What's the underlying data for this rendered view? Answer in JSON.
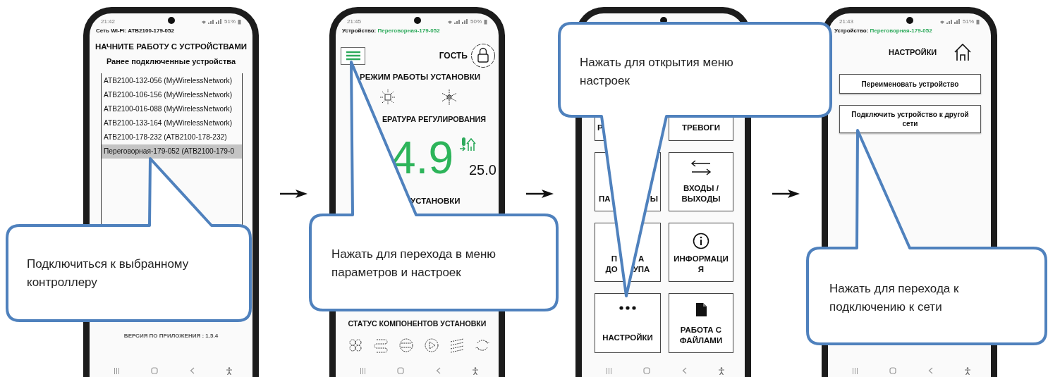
{
  "screens": [
    {
      "kind": "device_list",
      "status_bar": {
        "time": "21:42",
        "battery": "51%"
      },
      "wifi_label": "Сеть Wi-Fi: ATB2100-179-052",
      "title": "НАЧНИТЕ РАБОТУ С УСТРОЙСТВАМИ",
      "subtitle": "Ранее подключенные устройства",
      "devices": [
        {
          "label": "ATB2100-132-056 (MyWirelessNetwork)",
          "selected": false
        },
        {
          "label": "ATB2100-106-156 (MyWirelessNetwork)",
          "selected": false
        },
        {
          "label": "ATB2100-016-088 (MyWirelessNetwork)",
          "selected": false
        },
        {
          "label": "ATB2100-133-164 (MyWirelessNetwork)",
          "selected": false
        },
        {
          "label": "ATB2100-178-232 (ATB2100-178-232)",
          "selected": false
        },
        {
          "label": "Переговорная-179-052 (ATB2100-179-0",
          "selected": true
        }
      ],
      "version": "ВЕРСИЯ ПО ПРИЛОЖЕНИЯ : 1.5.4"
    },
    {
      "kind": "dashboard",
      "status_bar": {
        "time": "21:45",
        "battery": "50%"
      },
      "device_label": "Устройство:",
      "device_name": "Переговорная-179-052",
      "user": "ГОСТЬ",
      "mode_title": "РЕЖИМ РАБОТЫ УСТАНОВКИ",
      "temp_title": "ЕРАТУРА РЕГУЛИРОВАНИЯ",
      "temperature": "4.9",
      "setpoint": "25.0",
      "section_title": "УСТАНОВКИ",
      "status_title": "СТАТУС КОМПОНЕНТОВ УСТАНОВКИ"
    },
    {
      "kind": "menu",
      "tiles": [
        {
          "lines": [
            [
              "Р"
            ]
          ]
        },
        {
          "lines": [
            [
              "ТРЕВОГИ"
            ]
          ]
        },
        {
          "lines": [
            [
              "ПА",
              "Ы"
            ]
          ]
        },
        {
          "lines": [
            [
              "ВХОДЫ /"
            ],
            [
              "ВЫХОДЫ"
            ]
          ]
        },
        {
          "lines": [
            [
              "П",
              "А"
            ],
            [
              "ДО",
              "УПА"
            ]
          ]
        },
        {
          "lines": [
            [
              "ИНФОРМАЦИ"
            ],
            [
              "Я"
            ]
          ]
        },
        {
          "lines": [
            [
              "НАСТРОЙКИ"
            ]
          ]
        },
        {
          "lines": [
            [
              "РАБОТА С"
            ],
            [
              "ФАЙЛАМИ"
            ]
          ]
        }
      ]
    },
    {
      "kind": "settings",
      "status_bar": {
        "time": "21:43",
        "battery": "51%"
      },
      "device_label": "Устройство:",
      "device_name": "Переговорная-179-052",
      "title": "НАСТРОЙКИ",
      "buttons": [
        "Переименовать устройство",
        "Подключить устройство к другой сети"
      ]
    }
  ],
  "callouts": [
    {
      "text": "Подключиться к выбранному контроллеру"
    },
    {
      "text": "Нажать для перехода в меню параметров и настроек"
    },
    {
      "text": "Нажать для открытия меню настроек"
    },
    {
      "text": "Нажать для перехода к подключению к сети"
    }
  ]
}
